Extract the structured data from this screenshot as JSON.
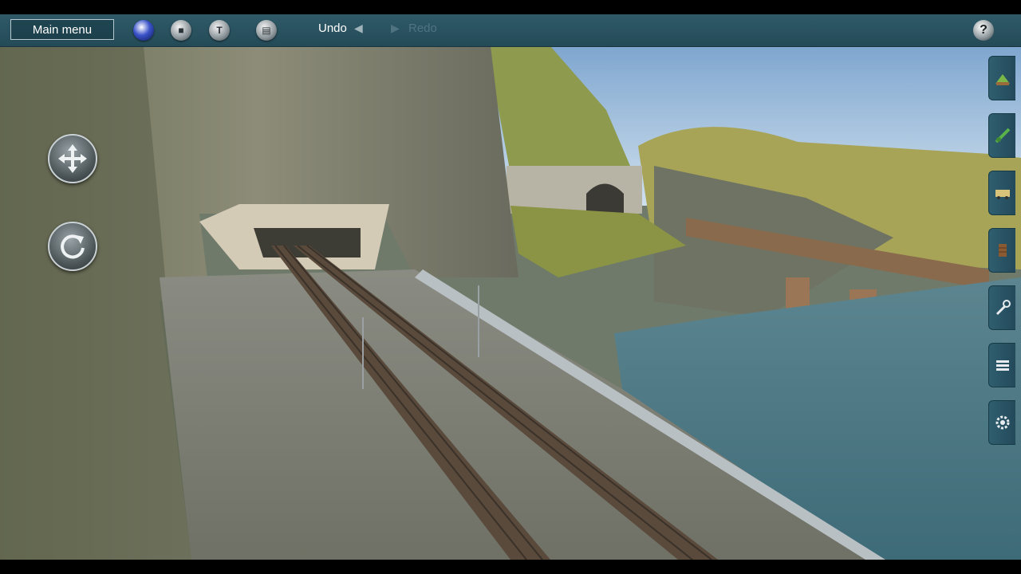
{
  "toolbar": {
    "main_menu_label": "Main menu",
    "undo_label": "Undo",
    "redo_label": "Redo",
    "icons": [
      "globe-icon",
      "stop-icon",
      "info-icon",
      "grid-icon"
    ],
    "help_label": "?"
  },
  "navigation": {
    "move_icon": "move-arrows-icon",
    "rotate_icon": "rotate-icon"
  },
  "side_tools": [
    "scenery-tool-icon",
    "track-tool-icon",
    "train-tool-icon",
    "structure-tool-icon",
    "wrench-tool-icon",
    "layers-tool-icon",
    "settings-tool-icon"
  ],
  "colors": {
    "toolbar_bg": "#2a5260",
    "accent": "#3a52c9"
  }
}
